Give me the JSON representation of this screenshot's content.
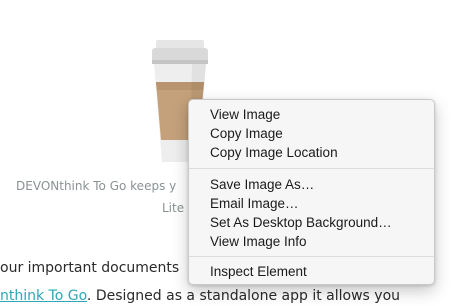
{
  "caption": {
    "line1": "DEVONthink To Go keeps y",
    "line2": "Lite"
  },
  "body_text": {
    "line1": "our important documents",
    "line2_link": "nthink To Go",
    "line2_rest": ". Designed as a standalone app it allows you"
  },
  "context_menu": {
    "items": [
      "View Image",
      "Copy Image",
      "Copy Image Location",
      "Save Image As…",
      "Email Image…",
      "Set As Desktop Background…",
      "View Image Info",
      "Inspect Element"
    ]
  },
  "colors": {
    "link": "#2fa6b4",
    "caption": "#8a9294",
    "menu_bg": "#f6f6f6"
  }
}
